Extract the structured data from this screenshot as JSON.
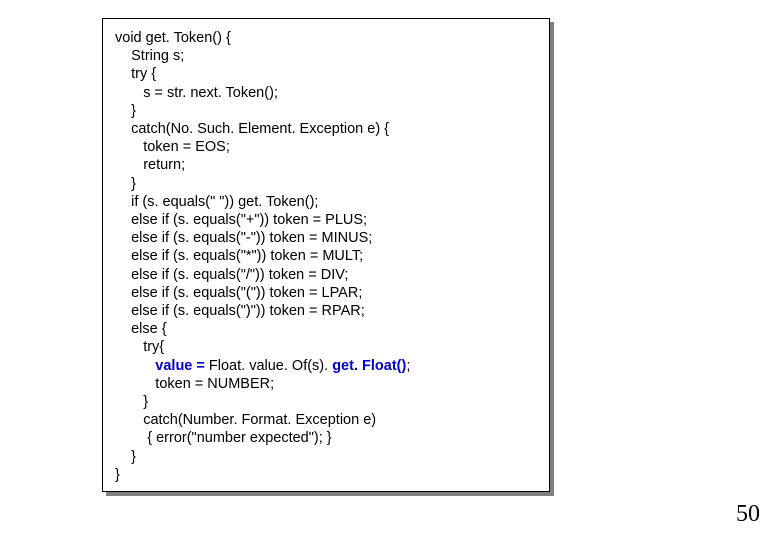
{
  "code": {
    "lines": [
      "void get. Token() {",
      "    String s;",
      "    try {",
      "       s = str. next. Token();",
      "    }",
      "    catch(No. Such. Element. Exception e) {",
      "       token = EOS;",
      "       return;",
      "    }",
      "    if (s. equals(\" \")) get. Token();",
      "    else if (s. equals(\"+\")) token = PLUS;",
      "    else if (s. equals(\"-\")) token = MINUS;",
      "    else if (s. equals(\"*\")) token = MULT;",
      "    else if (s. equals(\"/\")) token = DIV;",
      "    else if (s. equals(\"(\")) token = LPAR;",
      "    else if (s. equals(\")\")) token = RPAR;",
      "    else {",
      "       try{",
      "",
      "          token = NUMBER;",
      "       }",
      "       catch(Number. Format. Exception e)",
      "        { error(\"number expected\"); }",
      "    }",
      "}"
    ],
    "highlight_line_index": 18,
    "highlight_prefix": "          ",
    "highlight_part1": "value = ",
    "highlight_mid": "Float. value. Of(s).",
    "highlight_part2": " get. Float()",
    "highlight_suffix": ";"
  },
  "page_number": "50"
}
